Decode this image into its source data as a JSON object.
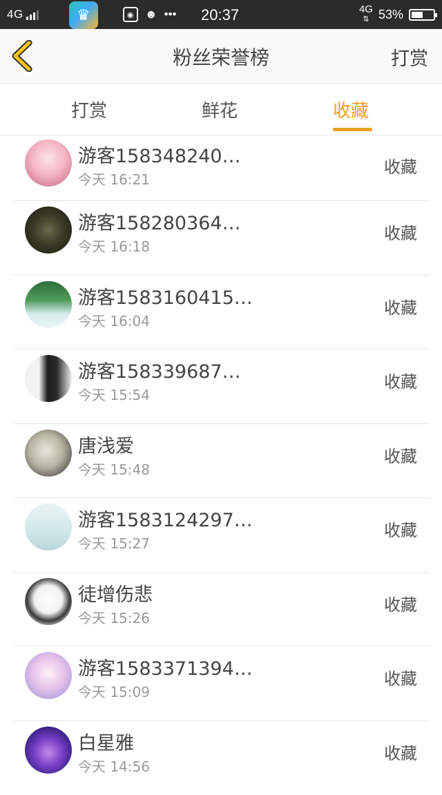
{
  "status_bar": {
    "network": "4G",
    "time": "20:37",
    "network_right": "4G",
    "battery": "53%"
  },
  "nav": {
    "title": "粉丝荣誉榜",
    "action": "打赏"
  },
  "tabs": [
    {
      "label": "打赏"
    },
    {
      "label": "鲜花"
    },
    {
      "label": "收藏"
    }
  ],
  "active_tab": "收藏",
  "accent_color": "#f0a020",
  "items": [
    {
      "name": "游客158348240…",
      "time": "今天 16:21",
      "action": "收藏"
    },
    {
      "name": "游客158280364…",
      "time": "今天 16:18",
      "action": "收藏"
    },
    {
      "name": "游客1583160415…",
      "time": "今天 16:04",
      "action": "收藏"
    },
    {
      "name": "游客158339687…",
      "time": "今天 15:54",
      "action": "收藏"
    },
    {
      "name": "唐浅爱",
      "time": "今天 15:48",
      "action": "收藏"
    },
    {
      "name": "游客1583124297…",
      "time": "今天 15:27",
      "action": "收藏"
    },
    {
      "name": "徒增伤悲",
      "time": "今天 15:26",
      "action": "收藏"
    },
    {
      "name": "游客1583371394…",
      "time": "今天 15:09",
      "action": "收藏"
    },
    {
      "name": "白星雅",
      "time": "今天 14:56",
      "action": "收藏"
    }
  ]
}
